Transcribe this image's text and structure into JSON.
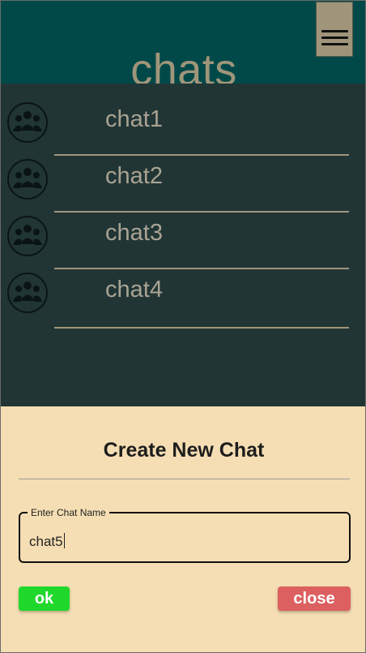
{
  "header": {
    "title": "chats",
    "menu_icon": "hamburger-icon"
  },
  "chats": [
    {
      "label": "chat1",
      "icon": "group-icon"
    },
    {
      "label": "chat2",
      "icon": "group-icon"
    },
    {
      "label": "chat3",
      "icon": "group-icon"
    },
    {
      "label": "chat4",
      "icon": "group-icon"
    }
  ],
  "dialog": {
    "title": "Create New Chat",
    "field_label": "Enter Chat Name",
    "field_value": "chat5",
    "ok_label": "ok",
    "close_label": "close"
  },
  "colors": {
    "header_bg": "#014949",
    "list_bg": "#213535",
    "accent": "#a0957a",
    "dialog_bg": "#f5deb3",
    "ok": "#1fd82b",
    "close": "#dc6060"
  }
}
